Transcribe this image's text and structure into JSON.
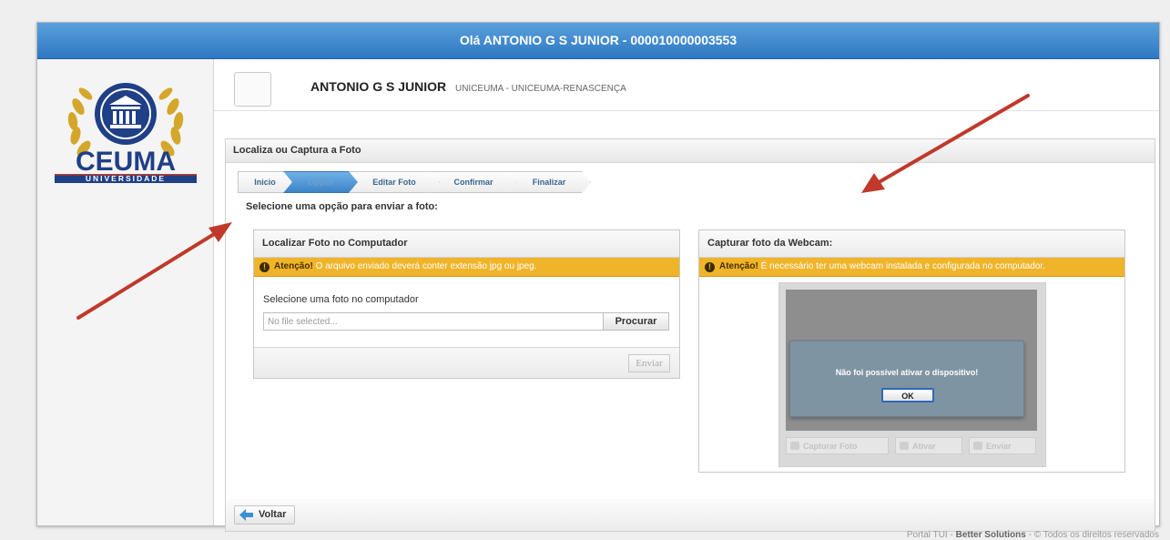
{
  "header": {
    "greeting": "Olá ANTONIO G S JUNIOR - 000010000003553"
  },
  "logo": {
    "name": "CEUMA",
    "subtitle": "UNIVERSIDADE"
  },
  "user": {
    "name": "ANTONIO G S JUNIOR",
    "org": "UNICEUMA - UNICEUMA-RENASCENÇA"
  },
  "card": {
    "title": "Localiza ou Captura a Foto"
  },
  "wizard": {
    "steps": [
      "Inicio",
      "Opção",
      "Editar Foto",
      "Confirmar",
      "Finalizar"
    ],
    "active_step": "Opção"
  },
  "choose_label": "Selecione uma opção para enviar a foto:",
  "local": {
    "title": "Localizar Foto no Computador",
    "warning_strong": "Atenção!",
    "warning_text": " O arquivo enviado deverá conter extensão jpg ou jpeg.",
    "field_label": "Selecione uma foto no computador",
    "file_placeholder": "No file selected...",
    "browse_label": "Procurar",
    "send_label": "Enviar"
  },
  "webcam": {
    "title": "Capturar foto da Webcam:",
    "warning_strong": "Atenção!",
    "warning_text": " É necessário ter uma webcam instalada e configurada no computador.",
    "dialog_message": "Não foi possível ativar o dispositivo!",
    "ok_label": "OK",
    "capture_label": "Capturar Foto",
    "activate_label": "Ativar",
    "send_label": "Enviar"
  },
  "back_label": "Voltar",
  "footer": {
    "portal": "Portal TUI",
    "company": "Better Solutions",
    "rights": "© Todos os direitos reservados"
  },
  "colors": {
    "topbar": "#3b86cc",
    "warning": "#f0b42a",
    "arrow": "#c0392b",
    "dialog": "#7f94a3"
  }
}
